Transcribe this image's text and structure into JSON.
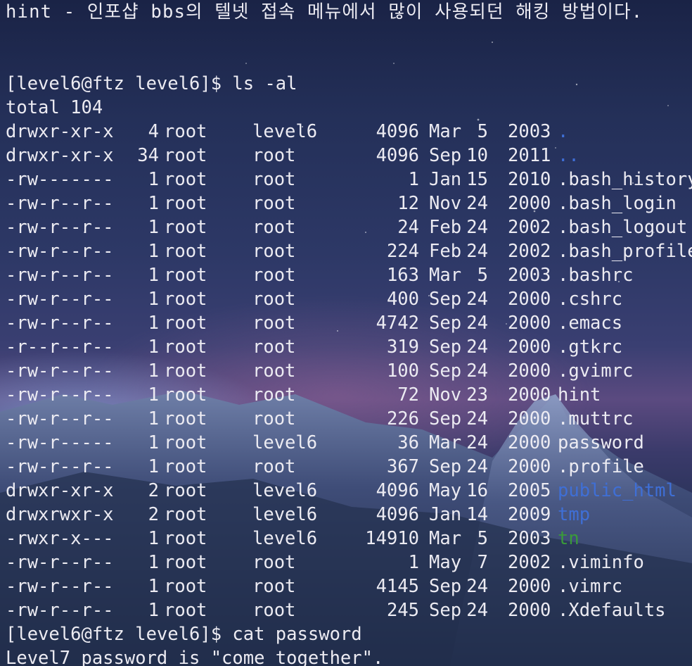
{
  "colors": {
    "text": "#ecebf2",
    "directory": "#3f6fd6",
    "executable": "#3a9a3a",
    "sky_top": "#1a2346",
    "sky_mid": "#3a3f72",
    "horizon": "#5b4a80"
  },
  "hint_line": "hint - 인포샵 bbs의 텔넷 접속 메뉴에서 많이 사용되던 해킹 방법이다.",
  "prompt1": "[level6@ftz level6]$ ls -al",
  "total": "total 104",
  "entries": [
    {
      "perm": "drwxr-xr-x",
      "links": "4",
      "owner": "root",
      "group": "level6",
      "size": "4096",
      "month": "Mar",
      "day": "5",
      "year": "2003",
      "name": ".",
      "type": "dir"
    },
    {
      "perm": "drwxr-xr-x",
      "links": "34",
      "owner": "root",
      "group": "root",
      "size": "4096",
      "month": "Sep",
      "day": "10",
      "year": "2011",
      "name": "..",
      "type": "dir"
    },
    {
      "perm": "-rw-------",
      "links": "1",
      "owner": "root",
      "group": "root",
      "size": "1",
      "month": "Jan",
      "day": "15",
      "year": "2010",
      "name": ".bash_history",
      "type": "file"
    },
    {
      "perm": "-rw-r--r--",
      "links": "1",
      "owner": "root",
      "group": "root",
      "size": "12",
      "month": "Nov",
      "day": "24",
      "year": "2000",
      "name": ".bash_login",
      "type": "file"
    },
    {
      "perm": "-rw-r--r--",
      "links": "1",
      "owner": "root",
      "group": "root",
      "size": "24",
      "month": "Feb",
      "day": "24",
      "year": "2002",
      "name": ".bash_logout",
      "type": "file"
    },
    {
      "perm": "-rw-r--r--",
      "links": "1",
      "owner": "root",
      "group": "root",
      "size": "224",
      "month": "Feb",
      "day": "24",
      "year": "2002",
      "name": ".bash_profile",
      "type": "file"
    },
    {
      "perm": "-rw-r--r--",
      "links": "1",
      "owner": "root",
      "group": "root",
      "size": "163",
      "month": "Mar",
      "day": "5",
      "year": "2003",
      "name": ".bashrc",
      "type": "file"
    },
    {
      "perm": "-rw-r--r--",
      "links": "1",
      "owner": "root",
      "group": "root",
      "size": "400",
      "month": "Sep",
      "day": "24",
      "year": "2000",
      "name": ".cshrc",
      "type": "file"
    },
    {
      "perm": "-rw-r--r--",
      "links": "1",
      "owner": "root",
      "group": "root",
      "size": "4742",
      "month": "Sep",
      "day": "24",
      "year": "2000",
      "name": ".emacs",
      "type": "file"
    },
    {
      "perm": "-r--r--r--",
      "links": "1",
      "owner": "root",
      "group": "root",
      "size": "319",
      "month": "Sep",
      "day": "24",
      "year": "2000",
      "name": ".gtkrc",
      "type": "file"
    },
    {
      "perm": "-rw-r--r--",
      "links": "1",
      "owner": "root",
      "group": "root",
      "size": "100",
      "month": "Sep",
      "day": "24",
      "year": "2000",
      "name": ".gvimrc",
      "type": "file"
    },
    {
      "perm": "-rw-r--r--",
      "links": "1",
      "owner": "root",
      "group": "root",
      "size": "72",
      "month": "Nov",
      "day": "23",
      "year": "2000",
      "name": "hint",
      "type": "file"
    },
    {
      "perm": "-rw-r--r--",
      "links": "1",
      "owner": "root",
      "group": "root",
      "size": "226",
      "month": "Sep",
      "day": "24",
      "year": "2000",
      "name": ".muttrc",
      "type": "file"
    },
    {
      "perm": "-rw-r-----",
      "links": "1",
      "owner": "root",
      "group": "level6",
      "size": "36",
      "month": "Mar",
      "day": "24",
      "year": "2000",
      "name": "password",
      "type": "file"
    },
    {
      "perm": "-rw-r--r--",
      "links": "1",
      "owner": "root",
      "group": "root",
      "size": "367",
      "month": "Sep",
      "day": "24",
      "year": "2000",
      "name": ".profile",
      "type": "file"
    },
    {
      "perm": "drwxr-xr-x",
      "links": "2",
      "owner": "root",
      "group": "level6",
      "size": "4096",
      "month": "May",
      "day": "16",
      "year": "2005",
      "name": "public_html",
      "type": "dir"
    },
    {
      "perm": "drwxrwxr-x",
      "links": "2",
      "owner": "root",
      "group": "level6",
      "size": "4096",
      "month": "Jan",
      "day": "14",
      "year": "2009",
      "name": "tmp",
      "type": "dir"
    },
    {
      "perm": "-rwxr-x---",
      "links": "1",
      "owner": "root",
      "group": "level6",
      "size": "14910",
      "month": "Mar",
      "day": "5",
      "year": "2003",
      "name": "tn",
      "type": "exec"
    },
    {
      "perm": "-rw-r--r--",
      "links": "1",
      "owner": "root",
      "group": "root",
      "size": "1",
      "month": "May",
      "day": "7",
      "year": "2002",
      "name": ".viminfo",
      "type": "file"
    },
    {
      "perm": "-rw-r--r--",
      "links": "1",
      "owner": "root",
      "group": "root",
      "size": "4145",
      "month": "Sep",
      "day": "24",
      "year": "2000",
      "name": ".vimrc",
      "type": "file"
    },
    {
      "perm": "-rw-r--r--",
      "links": "1",
      "owner": "root",
      "group": "root",
      "size": "245",
      "month": "Sep",
      "day": "24",
      "year": "2000",
      "name": ".Xdefaults",
      "type": "file"
    }
  ],
  "prompt2": "[level6@ftz level6]$ cat password",
  "output": "Level7 password is \"come together\"."
}
